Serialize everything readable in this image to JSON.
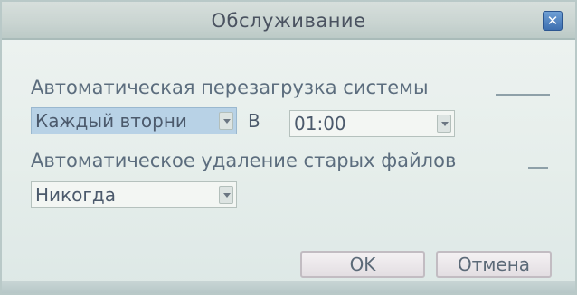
{
  "dialog": {
    "title": "Обслуживание",
    "close_symbol": "✕"
  },
  "reboot": {
    "label": "Автоматическая перезагрузка системы",
    "day_value": "Каждый вторни",
    "at_label": "В",
    "time_value": "01:00"
  },
  "cleanup": {
    "label": "Автоматическое удаление старых файлов",
    "value": "Никогда"
  },
  "buttons": {
    "ok_label": "OK",
    "cancel_label": "Отмена"
  },
  "icons": {
    "close": "close-icon",
    "dropdown": "chevron-down-icon"
  },
  "colors": {
    "highlight": "#b8d2e6",
    "close_button": "#3d6fb0"
  }
}
